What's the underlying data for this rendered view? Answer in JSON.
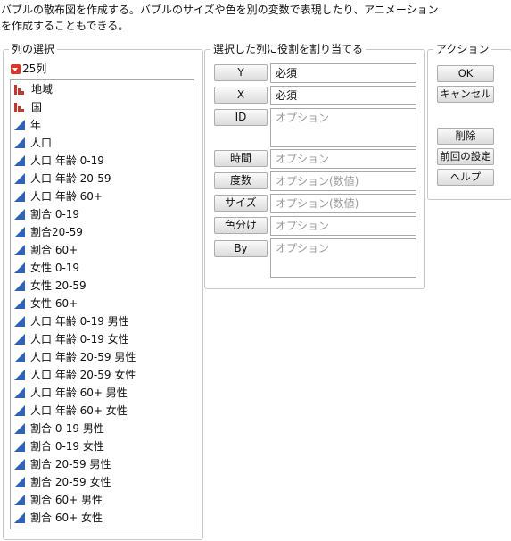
{
  "description": {
    "line1": "バブルの散布図を作成する。バブルのサイズや色を別の変数で表現したり、アニメーション",
    "line2": "を作成することもできる。"
  },
  "column_select": {
    "title": "列の選択",
    "count_label": "25列",
    "items": [
      {
        "label": "地域",
        "icon": "nominal-bar-icon"
      },
      {
        "label": "国",
        "icon": "nominal-bar-icon"
      },
      {
        "label": "年",
        "icon": "continuous-triangle-icon"
      },
      {
        "label": "人口",
        "icon": "continuous-triangle-icon"
      },
      {
        "label": "人口 年齢 0-19",
        "icon": "continuous-triangle-icon"
      },
      {
        "label": "人口 年齢 20-59",
        "icon": "continuous-triangle-icon"
      },
      {
        "label": "人口 年齢 60+",
        "icon": "continuous-triangle-icon"
      },
      {
        "label": "割合 0-19",
        "icon": "continuous-triangle-icon"
      },
      {
        "label": "割合20-59",
        "icon": "continuous-triangle-icon"
      },
      {
        "label": "割合 60+",
        "icon": "continuous-triangle-icon"
      },
      {
        "label": "女性 0-19",
        "icon": "continuous-triangle-icon"
      },
      {
        "label": "女性 20-59",
        "icon": "continuous-triangle-icon"
      },
      {
        "label": "女性 60+",
        "icon": "continuous-triangle-icon"
      },
      {
        "label": "人口 年齢 0-19 男性",
        "icon": "continuous-triangle-icon"
      },
      {
        "label": "人口 年齢 0-19 女性",
        "icon": "continuous-triangle-icon"
      },
      {
        "label": "人口 年齢 20-59 男性",
        "icon": "continuous-triangle-icon"
      },
      {
        "label": "人口 年齢 20-59 女性",
        "icon": "continuous-triangle-icon"
      },
      {
        "label": "人口 年齢 60+ 男性",
        "icon": "continuous-triangle-icon"
      },
      {
        "label": "人口 年齢 60+ 女性",
        "icon": "continuous-triangle-icon"
      },
      {
        "label": "割合 0-19 男性",
        "icon": "continuous-triangle-icon"
      },
      {
        "label": "割合 0-19 女性",
        "icon": "continuous-triangle-icon"
      },
      {
        "label": "割合 20-59 男性",
        "icon": "continuous-triangle-icon"
      },
      {
        "label": "割合 20-59 女性",
        "icon": "continuous-triangle-icon"
      },
      {
        "label": "割合 60+ 男性",
        "icon": "continuous-triangle-icon"
      },
      {
        "label": "割合 60+ 女性",
        "icon": "continuous-triangle-icon"
      }
    ]
  },
  "roles": {
    "title": "選択した列に役割を割り当てる",
    "rows": [
      {
        "button": "Y",
        "value": "必須",
        "placeholder": false
      },
      {
        "button": "X",
        "value": "必須",
        "placeholder": false
      },
      {
        "button": "ID",
        "value": "オプション",
        "placeholder": true
      },
      {
        "button": "時間",
        "value": "オプション",
        "placeholder": true
      },
      {
        "button": "度数",
        "value": "オプション(数値)",
        "placeholder": true
      },
      {
        "button": "サイズ",
        "value": "オプション(数値)",
        "placeholder": true
      },
      {
        "button": "色分け",
        "value": "オプション",
        "placeholder": true
      },
      {
        "button": "By",
        "value": "オプション",
        "placeholder": true
      }
    ]
  },
  "actions": {
    "title": "アクション",
    "ok": "OK",
    "cancel": "キャンセル",
    "remove": "削除",
    "recall": "前回の設定",
    "help": "ヘルプ"
  },
  "colors": {
    "nominal_icon": "#c0392b",
    "continuous_icon": "#2f63b5",
    "menu_triangle": "#d9352b"
  }
}
